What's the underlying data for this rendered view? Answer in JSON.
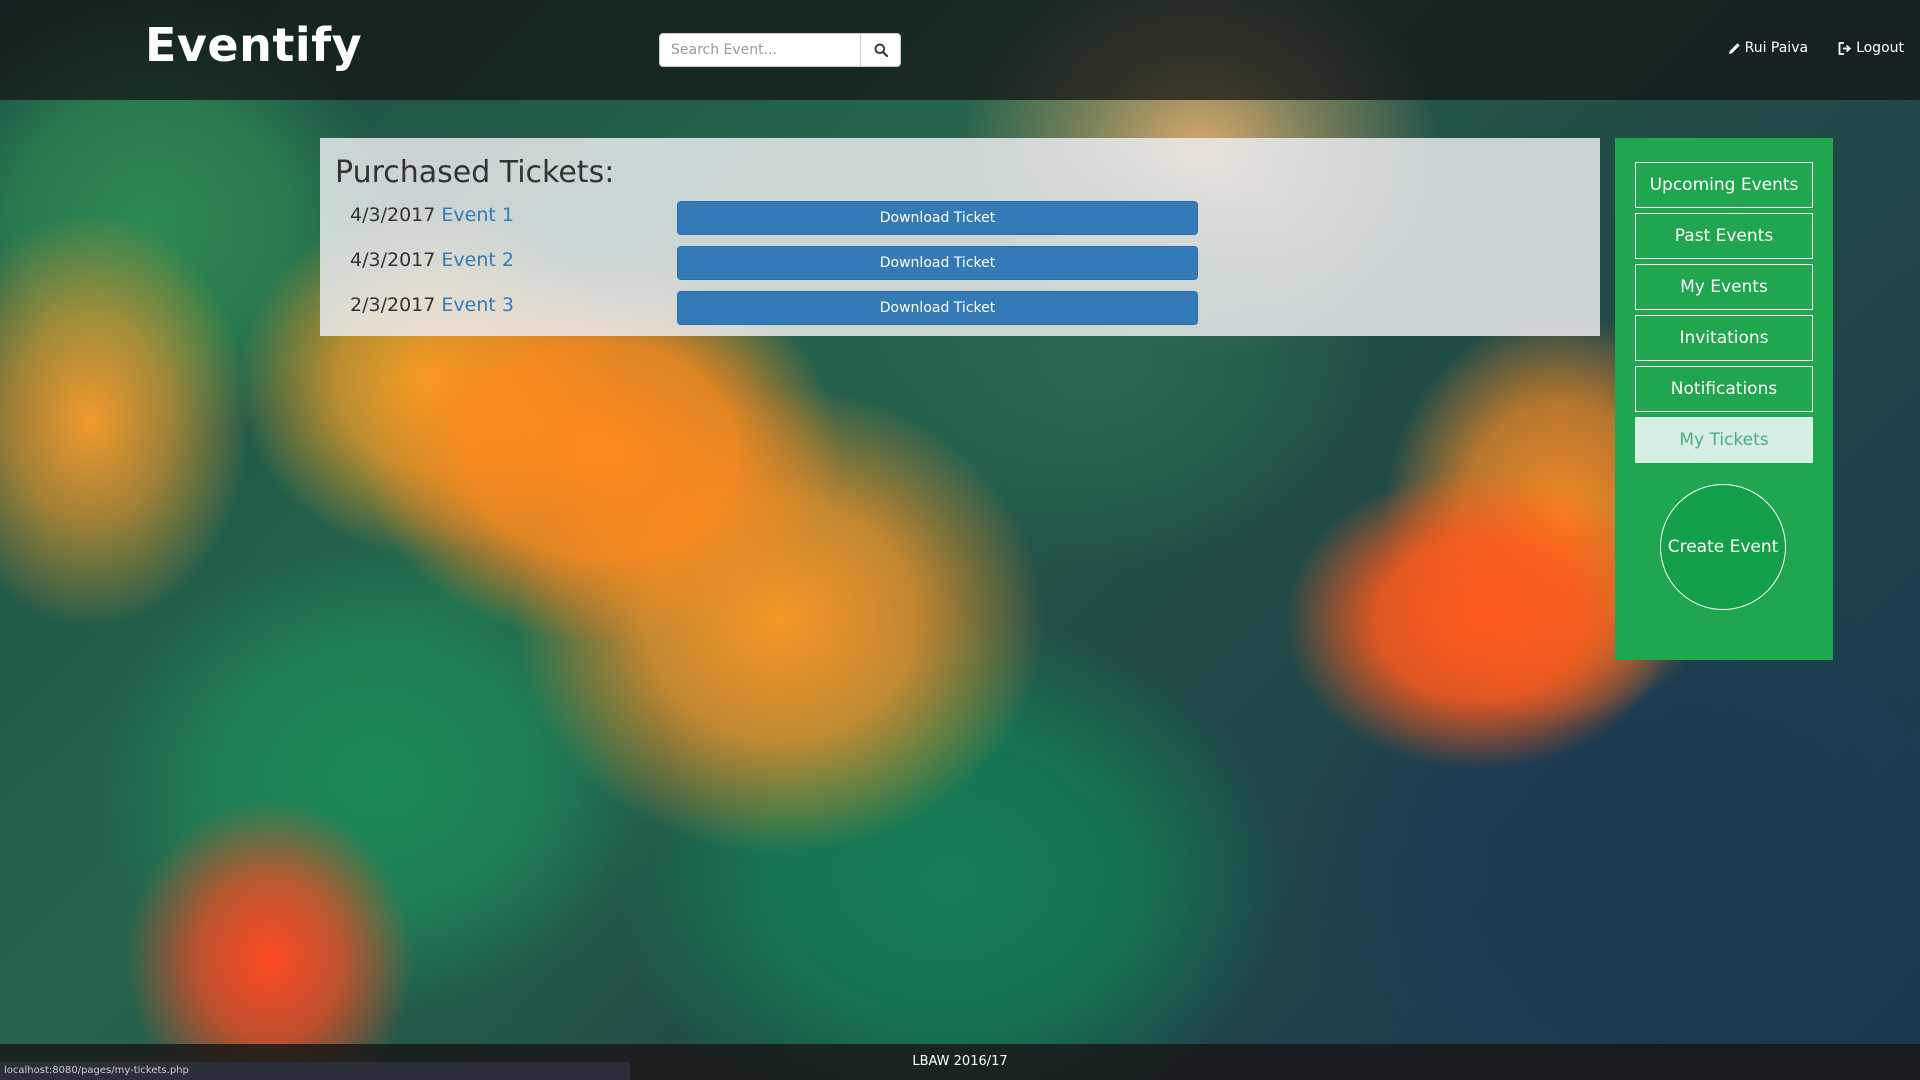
{
  "navbar": {
    "brand": "Eventify",
    "search": {
      "placeholder": "Search Event...",
      "value": "",
      "button_icon": "search-icon"
    },
    "user_link": {
      "label": "Rui Paiva",
      "icon": "pencil-icon"
    },
    "logout_link": {
      "label": "Logout",
      "icon": "logout-icon"
    }
  },
  "main": {
    "title": "Purchased Tickets:",
    "tickets": [
      {
        "date": "4/3/2017",
        "event": "Event 1",
        "button_label": "Download Ticket"
      },
      {
        "date": "4/3/2017",
        "event": "Event 2",
        "button_label": "Download Ticket"
      },
      {
        "date": "2/3/2017",
        "event": "Event 3",
        "button_label": "Download Ticket"
      }
    ]
  },
  "sidebar": {
    "items": [
      {
        "label": "Upcoming Events",
        "active": false
      },
      {
        "label": "Past Events",
        "active": false
      },
      {
        "label": "My Events",
        "active": false
      },
      {
        "label": "Invitations",
        "active": false
      },
      {
        "label": "Notifications",
        "active": false
      },
      {
        "label": "My Tickets",
        "active": true
      }
    ],
    "create_button": "Create Event"
  },
  "footer": {
    "text": "LBAW 2016/17"
  },
  "status_bar": {
    "url": "localhost:8080/pages/my-tickets.php"
  },
  "colors": {
    "sidebar_green": "#1fa64e",
    "primary_blue": "#337ab7",
    "active_item_bg": "#d6efe3"
  }
}
